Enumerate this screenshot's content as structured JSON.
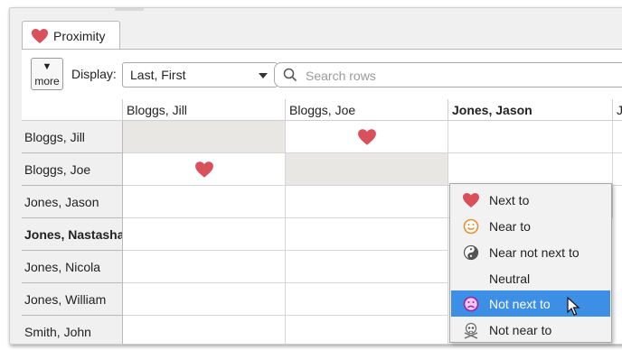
{
  "tab": {
    "label": "Proximity",
    "icon": "heart-icon"
  },
  "toolbar": {
    "more_label": "more",
    "display_label": "Display:",
    "display_value": "Last, First",
    "search_placeholder": "Search rows"
  },
  "columns": [
    "Bloggs, Jill",
    "Bloggs, Joe",
    "Jones, Jason",
    "Jo"
  ],
  "rows": [
    "Bloggs, Jill",
    "Bloggs, Joe",
    "Jones, Jason",
    "Jones, Nastasha",
    "Jones, Nicola",
    "Jones, William",
    "Smith, John"
  ],
  "menu": {
    "items": [
      {
        "label": "Next to",
        "icon": "heart-icon"
      },
      {
        "label": "Near to",
        "icon": "smiley-icon"
      },
      {
        "label": "Near not next to",
        "icon": "yin-yang-icon"
      },
      {
        "label": "Neutral",
        "icon": ""
      },
      {
        "label": "Not next to",
        "icon": "frown-icon"
      },
      {
        "label": "Not near to",
        "icon": "skull-crossbones-icon"
      }
    ]
  },
  "colors": {
    "heart": "#d94f5c",
    "selection": "#3d8fe6",
    "self_cell": "#e9e7e3"
  }
}
